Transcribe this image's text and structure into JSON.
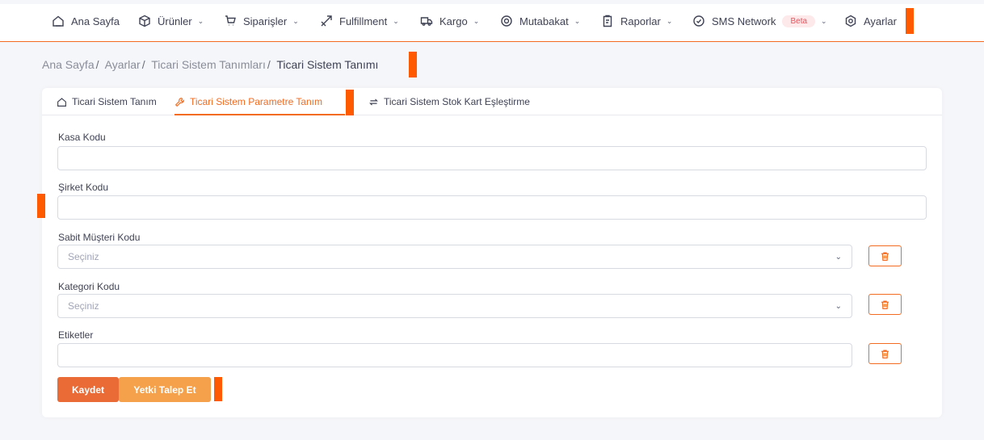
{
  "nav": {
    "items": [
      {
        "label": "Ana Sayfa",
        "icon": "home-icon",
        "has_dropdown": false
      },
      {
        "label": "Ürünler",
        "icon": "cube-icon",
        "has_dropdown": true
      },
      {
        "label": "Siparişler",
        "icon": "cart-icon",
        "has_dropdown": true
      },
      {
        "label": "Fulfillment",
        "icon": "plane-icon",
        "has_dropdown": true
      },
      {
        "label": "Kargo",
        "icon": "truck-icon",
        "has_dropdown": true
      },
      {
        "label": "Mutabakat",
        "icon": "coin-icon",
        "has_dropdown": true
      },
      {
        "label": "Raporlar",
        "icon": "report-icon",
        "has_dropdown": true
      },
      {
        "label": "SMS Network",
        "icon": "check-circle-icon",
        "has_dropdown": true,
        "badge": "Beta"
      },
      {
        "label": "Ayarlar",
        "icon": "gear-icon",
        "has_dropdown": false
      }
    ]
  },
  "breadcrumb": {
    "items": [
      "Ana Sayfa",
      "Ayarlar",
      "Ticari Sistem Tanımları"
    ],
    "current": "Ticari Sistem Tanımı",
    "separator": "/"
  },
  "tabs": [
    {
      "label": "Ticari Sistem Tanım",
      "icon": "home-icon",
      "active": false
    },
    {
      "label": "Ticari Sistem Parametre Tanım",
      "icon": "wrench-icon",
      "active": true
    },
    {
      "label": "Ticari Sistem Stok Kart Eşleştirme",
      "icon": "swap-icon",
      "active": false
    }
  ],
  "form": {
    "kasa_kodu": {
      "label": "Kasa Kodu",
      "value": ""
    },
    "sirket_kodu": {
      "label": "Şirket Kodu",
      "value": ""
    },
    "sabit_musteri_kodu": {
      "label": "Sabit Müşteri Kodu",
      "placeholder": "Seçiniz"
    },
    "kategori_kodu": {
      "label": "Kategori Kodu",
      "placeholder": "Seçiniz"
    },
    "etiketler": {
      "label": "Etiketler",
      "value": ""
    }
  },
  "actions": {
    "save_label": "Kaydet",
    "request_label": "Yetki Talep Et"
  },
  "colors": {
    "accent": "#f26b21",
    "save_button": "#ea6b36",
    "request_button": "#f5a04a",
    "beta_badge_bg": "#fde8ea",
    "beta_badge_text": "#e6565f",
    "highlight_marker": "#ff5a00"
  }
}
